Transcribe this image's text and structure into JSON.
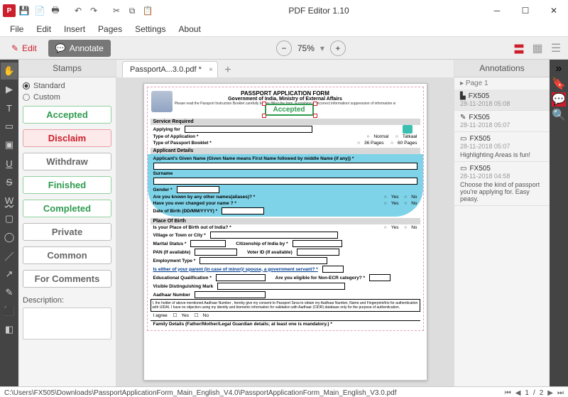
{
  "app": {
    "title": "PDF Editor 1.10"
  },
  "menu": {
    "file": "File",
    "edit": "Edit",
    "insert": "Insert",
    "pages": "Pages",
    "settings": "Settings",
    "about": "About"
  },
  "mode": {
    "edit": "Edit",
    "annotate": "Annotate"
  },
  "zoom": {
    "value": "75%"
  },
  "stamps": {
    "title": "Stamps",
    "standard": "Standard",
    "custom": "Custom",
    "items": [
      "Accepted",
      "Disclaim",
      "Withdraw",
      "Finished",
      "Completed",
      "Private",
      "Common",
      "For Comments"
    ],
    "desc_label": "Description:"
  },
  "tab": {
    "name": "PassportA...3.0.pdf *"
  },
  "doc": {
    "title": "PASSPORT APPLICATION FORM",
    "subtitle": "Government of India, Ministry of External Affairs",
    "note": "Please read the Passport Instruction Booklet carefully before filling the form. Furnishing of incorrect information/ suppression of information w",
    "stamp": "Accepted",
    "sections": {
      "service": "Service Required",
      "applicant": "Applicant Details",
      "pob": "Place Of Birth"
    },
    "fields": {
      "applying_for": "Applying for",
      "app_type": "Type of Application *",
      "normal": "Normal",
      "tatkaal": "Tatkaal",
      "booklet": "Type of Passport Booklet *",
      "p36": "36 Pages",
      "p60": "60 Pages",
      "given_name": "Applicant's Given Name (Given Name means First Name followed by middle Name (if any)) *",
      "surname": "Surname",
      "gender": "Gender *",
      "aliases": "Are you known by any other names(aliases)? *",
      "changed": "Have you ever changed your name ? *",
      "dob": "Date of Birth (DD/MM/YYYY) *",
      "yes": "Yes",
      "no": "No",
      "pob_out": "Is your Place of Birth out of India? *",
      "village": "Village or Town or City *",
      "marital": "Marital Status *",
      "citizenship": "Citizenship of India by *",
      "pan": "PAN (If available)",
      "voter": "Voter ID (If available)",
      "employment": "Employment Type *",
      "parent_gov": "Is either of your parent (in case of minor)/ spouse, a government servant? *",
      "edu": "Educational Qualification *",
      "non_ecr": "Are you eligible for Non-ECR category? *",
      "marks": "Visible Distinguishing Mark",
      "aadhaar": "Aadhaar Number",
      "aadhaar_consent": "I, the holder of above mentioned Aadhaar Number , hereby give my consent to Passport Seva to obtain my Aadhaar Number, Name and Fingerprint/Iris for authentication with UIDAI. I have no objection using my identity and biometric information for validation with Aadhaar (CIDR) database only for the purpose of authentication.",
      "agree": "I agree",
      "family": "Family Details (Father/Mother/Legal Guardian details; at least one is mandatory.) *"
    }
  },
  "annotations": {
    "title": "Annotations",
    "page_label": "Page 1",
    "items": [
      {
        "author": "FX505",
        "time": "28-11-2018 05:08",
        "text": "",
        "kind": "stamp"
      },
      {
        "author": "FX505",
        "time": "28-11-2018 05:07",
        "text": "",
        "kind": "edit"
      },
      {
        "author": "FX505",
        "time": "28-11-2018 05:07",
        "text": "Highlighting Areas is fun!",
        "kind": "note"
      },
      {
        "author": "FX505",
        "time": "28-11-2018 04:58",
        "text": "Choose the kind of passport you're applying for. Easy peasy.",
        "kind": "note"
      }
    ]
  },
  "status": {
    "path": "C:\\Users\\FX505\\Downloads\\PassportApplicationForm_Main_English_V4.0\\PassportApplicationForm_Main_English_V3.0.pdf",
    "page": "1",
    "total": "2"
  }
}
